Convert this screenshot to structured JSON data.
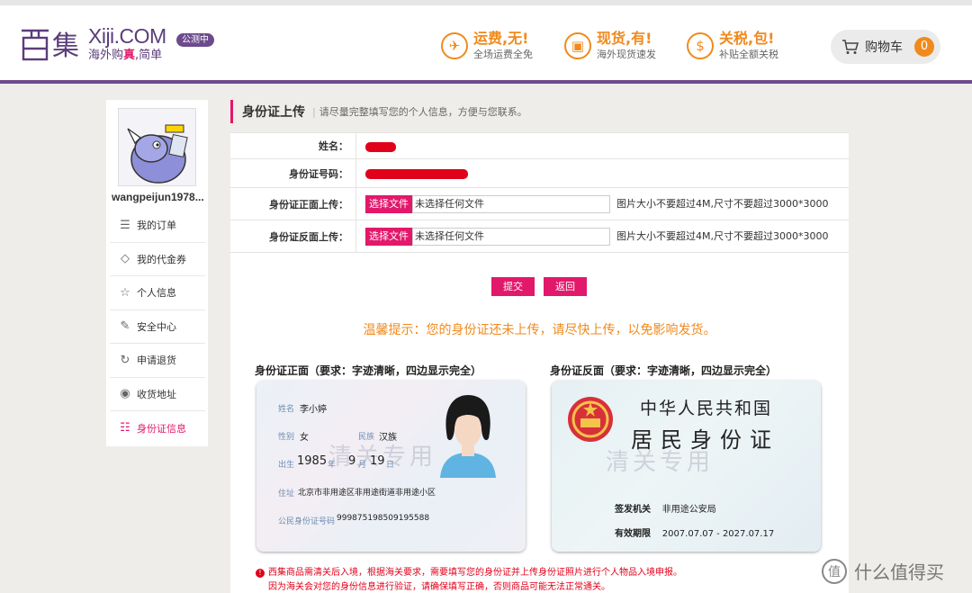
{
  "header": {
    "logo_cn": "西集",
    "logo_en": "Xiji.COM",
    "slogan_plain": "海外购",
    "slogan_strong": "真",
    "slogan_tail": ",简单",
    "beta_badge": "公测中",
    "promos": [
      {
        "icon": "plane-icon",
        "glyph": "✈",
        "title": "运费,无!",
        "subtitle": "全场运费全免"
      },
      {
        "icon": "gift-box-icon",
        "glyph": "▣",
        "title": "现货,有!",
        "subtitle": "海外现货速发"
      },
      {
        "icon": "money-bag-icon",
        "glyph": "$",
        "title": "关税,包!",
        "subtitle": "补贴全额关税"
      }
    ],
    "cart": {
      "label": "购物车",
      "count": "0"
    }
  },
  "sidebar": {
    "username": "wangpeijun1978...",
    "items": [
      {
        "icon": "order-list-icon",
        "glyph": "☰",
        "label": "我的订单"
      },
      {
        "icon": "coupon-tag-icon",
        "glyph": "◇",
        "label": "我的代金券"
      },
      {
        "icon": "star-icon",
        "glyph": "☆",
        "label": "个人信息"
      },
      {
        "icon": "edit-shield-icon",
        "glyph": "✎",
        "label": "安全中心"
      },
      {
        "icon": "refresh-icon",
        "glyph": "↻",
        "label": "申请退货"
      },
      {
        "icon": "location-pin-icon",
        "glyph": "◉",
        "label": "收货地址"
      },
      {
        "icon": "id-info-icon",
        "glyph": "☷",
        "label": "身份证信息"
      }
    ]
  },
  "page": {
    "title": "身份证上传",
    "description": "请尽量完整填写您的个人信息，方便与您联系。"
  },
  "form": {
    "name_label": "姓名：",
    "id_label": "身份证号码：",
    "front_label": "身份证正面上传：",
    "back_label": "身份证反面上传：",
    "choose_file": "选择文件",
    "no_file": "未选择任何文件",
    "hint": "图片大小不要超过4M,尺寸不要超过3000*3000",
    "submit": "提交",
    "back": "返回",
    "warning": "温馨提示：您的身份证还未上传，请尽快上传，以免影响发货。"
  },
  "samples": {
    "front_caption": "身份证正面（要求：字迹清晰，四边显示完全）",
    "back_caption": "身份证反面（要求：字迹清晰，四边显示完全）",
    "front": {
      "name_field": "姓名",
      "name_value": "李小婷",
      "sex_field": "性别",
      "sex_value": "女",
      "ethnic_field": "民族",
      "ethnic_value": "汉族",
      "birth_field": "出生",
      "birth_year": "1985",
      "year_unit": "年",
      "birth_month": "9",
      "month_unit": "月",
      "birth_day": "19",
      "day_unit": "日",
      "addr_field": "住址",
      "addr_value": "北京市非用途区非用途街道非用途小区",
      "id_field": "公民身份证号码",
      "id_value": "999875198509195588",
      "watermark": "清关专用"
    },
    "back": {
      "title_top": "中华人民共和国",
      "title_main": "居民身份证",
      "authority_field": "签发机关",
      "authority_value": "非用途公安局",
      "validity_field": "有效期限",
      "validity_value": "2007.07.07 - 2027.07.17",
      "watermark": "清关专用"
    }
  },
  "notes": [
    "西集商品需清关后入境，根据海关要求，需要填写您的身份证并上传身份证照片进行个人物品入境申报。",
    "因为海关会对您的身份信息进行验证，请确保填写正确，否则商品可能无法正常通关。"
  ],
  "footer_mark": "什么值得买",
  "colors": {
    "brand_purple": "#6d4a8c",
    "accent_pink": "#e2186b",
    "accent_orange": "#f08a1c",
    "redact_red": "#e0001a"
  }
}
